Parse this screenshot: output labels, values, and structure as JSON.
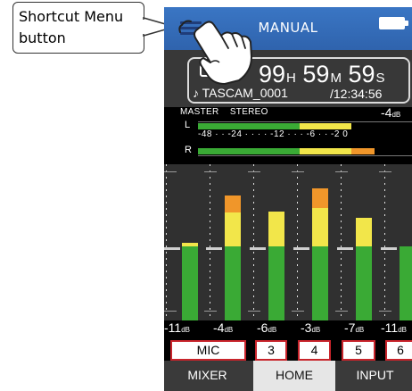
{
  "callout": {
    "text_line1": "Shortcut Menu",
    "text_line2": "button"
  },
  "header": {
    "mode": "MANUAL"
  },
  "recorder": {
    "remain": {
      "h": "99",
      "h_unit": "H",
      "m": "59",
      "m_unit": "M",
      "s": "59",
      "s_unit": "S"
    },
    "file_name": "♪ TASCAM_0001",
    "total_time": "/12:34:56"
  },
  "master": {
    "label": "MASTER",
    "mode": "STEREO",
    "value": "-4",
    "value_unit": "dB",
    "left_label": "L",
    "right_label": "R",
    "scale": "-48 · · -24 · · · · -12 · · · -6 · · -2 0"
  },
  "channels": [
    {
      "name": "MIC",
      "level": "-11",
      "unit": "dB"
    },
    {
      "name": "3",
      "level": "-4",
      "unit": "dB"
    },
    {
      "name": "4",
      "level": "-6",
      "unit": "dB"
    },
    {
      "name": "5",
      "level": "-3",
      "unit": "dB"
    },
    {
      "name": "6",
      "level": "-7",
      "unit": "dB"
    },
    {
      "name": "",
      "level": "-11",
      "unit": "dB"
    }
  ],
  "tabs": [
    "MIXER",
    "HOME",
    "INPUT"
  ],
  "colors": {
    "blue_bar": "#2f63ad",
    "meter_green": "#3aaa35",
    "meter_yellow": "#f2e64a",
    "meter_orange": "#f0962a",
    "button_red": "#c8242b"
  }
}
